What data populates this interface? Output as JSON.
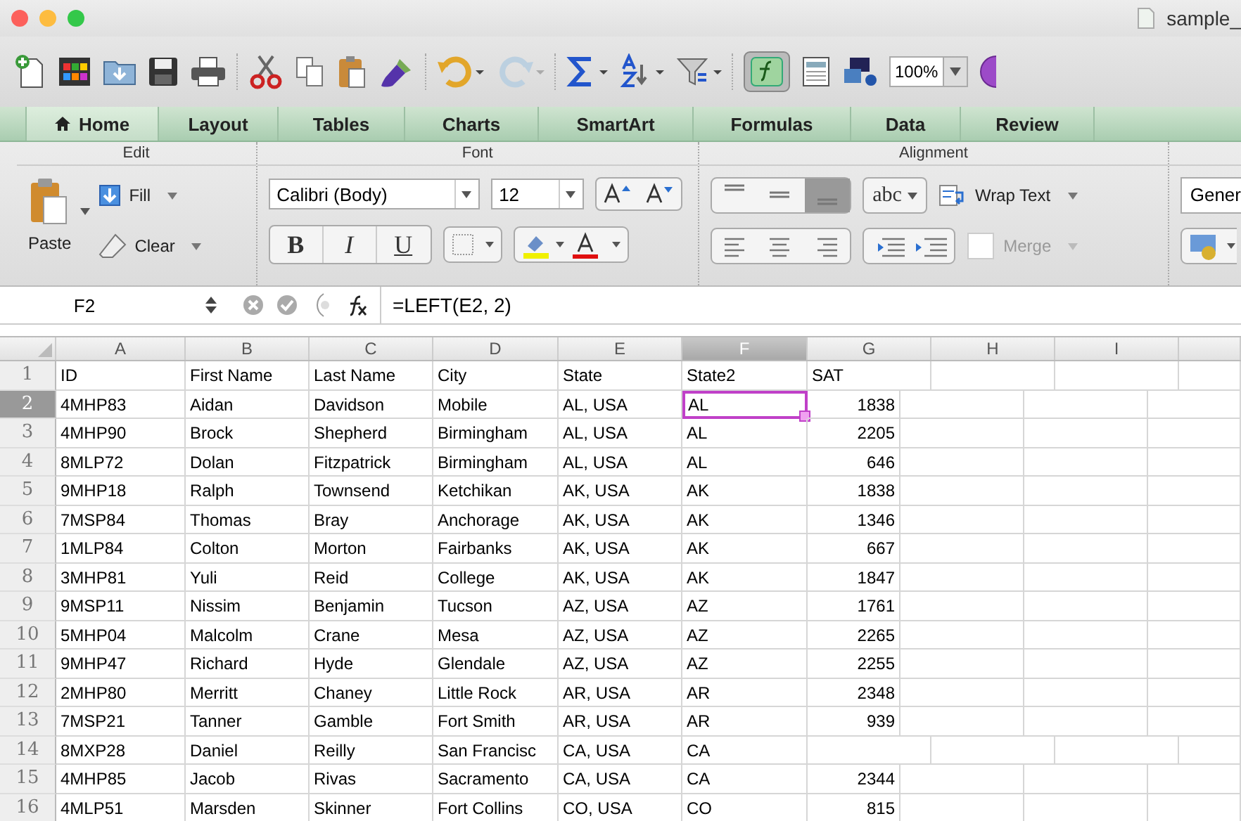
{
  "window": {
    "title": "sample_"
  },
  "toolbar": {
    "zoom": "100%"
  },
  "tabs": [
    {
      "label": "Home",
      "selected": true
    },
    {
      "label": "Layout",
      "selected": false
    },
    {
      "label": "Tables",
      "selected": false
    },
    {
      "label": "Charts",
      "selected": false
    },
    {
      "label": "SmartArt",
      "selected": false
    },
    {
      "label": "Formulas",
      "selected": false
    },
    {
      "label": "Data",
      "selected": false
    },
    {
      "label": "Review",
      "selected": false
    }
  ],
  "ribbon": {
    "groups": [
      "Edit",
      "Font",
      "Alignment"
    ],
    "paste": "Paste",
    "fill": "Fill",
    "clear": "Clear",
    "font_name": "Calibri (Body)",
    "font_size": "12",
    "bold": "B",
    "italic": "I",
    "underline": "U",
    "abc": "abc",
    "wrap_text": "Wrap Text",
    "merge": {
      "label": "Merge",
      "disabled": true
    },
    "number_format": "Gener"
  },
  "formula_bar": {
    "cell": "F2",
    "formula": "=LEFT(E2, 2)"
  },
  "sheet": {
    "columns": [
      {
        "label": "A",
        "selected": false
      },
      {
        "label": "B",
        "selected": false
      },
      {
        "label": "C",
        "selected": false
      },
      {
        "label": "D",
        "selected": false
      },
      {
        "label": "E",
        "selected": false
      },
      {
        "label": "F",
        "selected": true
      },
      {
        "label": "G",
        "selected": false
      },
      {
        "label": "H",
        "selected": false
      },
      {
        "label": "I",
        "selected": false
      }
    ],
    "rows": [
      {
        "number": "1",
        "selected": false,
        "cells": [
          "ID",
          "First Name",
          "Last Name",
          "City",
          "State",
          "State2",
          "SAT"
        ]
      },
      {
        "number": "2",
        "selected": true,
        "cells": [
          "4MHP83",
          "Aidan",
          "Davidson",
          "Mobile",
          "AL, USA",
          "AL",
          "1838"
        ]
      },
      {
        "number": "3",
        "selected": false,
        "cells": [
          "4MHP90",
          " Brock",
          "Shepherd",
          "Birmingham",
          "AL, USA",
          "AL",
          "2205"
        ]
      },
      {
        "number": "4",
        "selected": false,
        "cells": [
          "8MLP72",
          "Dolan",
          "Fitzpatrick",
          "Birmingham",
          "AL, USA",
          "AL",
          "646"
        ]
      },
      {
        "number": "5",
        "selected": false,
        "cells": [
          "9MHP18",
          "Ralph",
          "Townsend",
          "Ketchikan",
          "AK, USA",
          "AK",
          "1838"
        ]
      },
      {
        "number": "6",
        "selected": false,
        "cells": [
          "7MSP84",
          "Thomas",
          "Bray",
          "Anchorage",
          "AK, USA",
          "AK",
          "1346"
        ]
      },
      {
        "number": "7",
        "selected": false,
        "cells": [
          "1MLP84",
          "Colton",
          "Morton",
          "Fairbanks",
          "AK, USA",
          "AK",
          "667"
        ]
      },
      {
        "number": "8",
        "selected": false,
        "cells": [
          "3MHP81",
          "Yuli",
          "Reid",
          "College",
          "AK, USA",
          "AK",
          "1847"
        ]
      },
      {
        "number": "9",
        "selected": false,
        "cells": [
          "9MSP11",
          "Nissim",
          "Benjamin",
          "Tucson",
          "AZ, USA",
          "AZ",
          "1761"
        ]
      },
      {
        "number": "10",
        "selected": false,
        "cells": [
          "5MHP04",
          "Malcolm",
          "Crane",
          "Mesa",
          "AZ, USA",
          "AZ",
          "2265"
        ]
      },
      {
        "number": "11",
        "selected": false,
        "cells": [
          "9MHP47",
          "Richard",
          "Hyde",
          "Glendale",
          "AZ, USA",
          "AZ",
          "2255"
        ]
      },
      {
        "number": "12",
        "selected": false,
        "cells": [
          "2MHP80",
          "Merritt",
          "Chaney",
          "Little Rock",
          "AR, USA",
          "AR",
          "2348"
        ]
      },
      {
        "number": "13",
        "selected": false,
        "cells": [
          "7MSP21",
          "Tanner",
          "Gamble",
          "Fort Smith",
          "AR, USA",
          "AR",
          "939"
        ]
      },
      {
        "number": "14",
        "selected": false,
        "cells": [
          "8MXP28",
          "Daniel",
          "Reilly",
          "San Francisc",
          "CA, USA",
          "CA",
          null
        ]
      },
      {
        "number": "15",
        "selected": false,
        "cells": [
          "4MHP85",
          "Jacob",
          "Rivas",
          "Sacramento",
          "CA, USA",
          "CA",
          "2344"
        ]
      },
      {
        "number": "16",
        "selected": false,
        "cells": [
          "4MLP51",
          "Marsden",
          "Skinner",
          "Fort Collins",
          "CO, USA",
          "CO",
          "815"
        ]
      }
    ]
  }
}
